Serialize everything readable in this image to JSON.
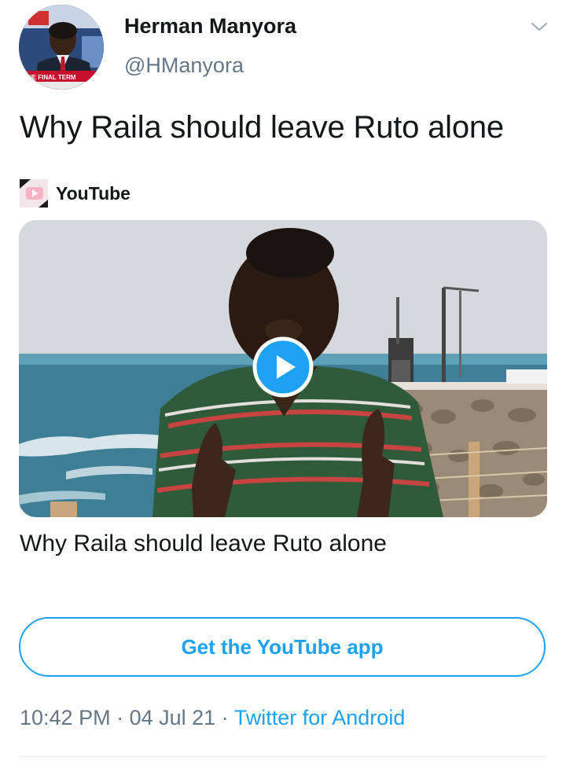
{
  "tweet": {
    "author_name": "Herman Manyora",
    "author_handle": "@HManyora",
    "text": "Why Raila should leave Ruto alone",
    "avatar_caption": "THE FINAL TERM"
  },
  "card": {
    "source_name": "YouTube",
    "title": "Why Raila should leave Ruto alone",
    "cta_label": "Get the YouTube app"
  },
  "meta": {
    "time": "10:42 PM",
    "separator": "·",
    "date": "04 Jul 21",
    "source": "Twitter for Android"
  },
  "icons": {
    "menu": "chevron-down-icon",
    "play": "play-icon",
    "source_logo": "youtube-icon"
  },
  "colors": {
    "accent": "#1da1f2",
    "text": "#14171a",
    "secondary": "#657786"
  }
}
